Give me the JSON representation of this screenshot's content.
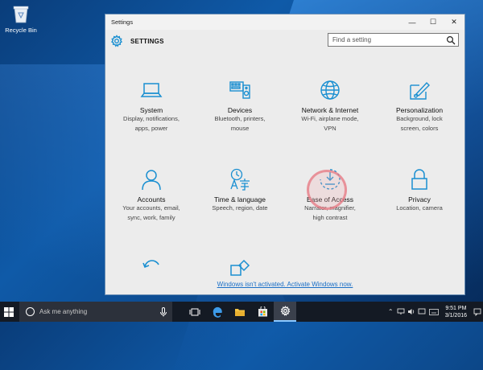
{
  "desktop": {
    "recycle_bin_label": "Recycle Bin"
  },
  "window": {
    "title": "Settings",
    "controls": {
      "minimize": "—",
      "maximize": "☐",
      "close": "✕"
    },
    "header_title": "SETTINGS",
    "search": {
      "placeholder": "Find a setting"
    },
    "accent_color": "#1a8fd1",
    "tiles": [
      {
        "name": "System",
        "desc": [
          "Display, notifications,",
          "apps, power"
        ],
        "icon": "laptop-icon"
      },
      {
        "name": "Devices",
        "desc": [
          "Bluetooth, printers,",
          "mouse"
        ],
        "icon": "devices-icon"
      },
      {
        "name": "Network & Internet",
        "desc": [
          "Wi-Fi, airplane mode,",
          "VPN"
        ],
        "icon": "globe-icon"
      },
      {
        "name": "Personalization",
        "desc": [
          "Background, lock",
          "screen, colors"
        ],
        "icon": "paint-brush-icon"
      },
      {
        "name": "Accounts",
        "desc": [
          "Your accounts, email,",
          "sync, work, family"
        ],
        "icon": "person-icon"
      },
      {
        "name": "Time & language",
        "desc": [
          "Speech, region, date"
        ],
        "icon": "time-language-icon"
      },
      {
        "name": "Ease of Access",
        "desc": [
          "Narrator, magnifier,",
          "high contrast"
        ],
        "icon": "ease-of-access-icon"
      },
      {
        "name": "Privacy",
        "desc": [
          "Location, camera"
        ],
        "icon": "lock-icon"
      }
    ],
    "partial_tiles": [
      "update-security-icon",
      "apps-icon"
    ],
    "activation_link": "Windows isn't activated. Activate Windows now."
  },
  "taskbar": {
    "search_text": "Ask me anything",
    "apps": [
      "task-view-icon",
      "edge-icon",
      "file-explorer-icon",
      "store-icon",
      "settings-icon"
    ],
    "clock": {
      "time": "9:51 PM",
      "date": "3/1/2016"
    }
  }
}
